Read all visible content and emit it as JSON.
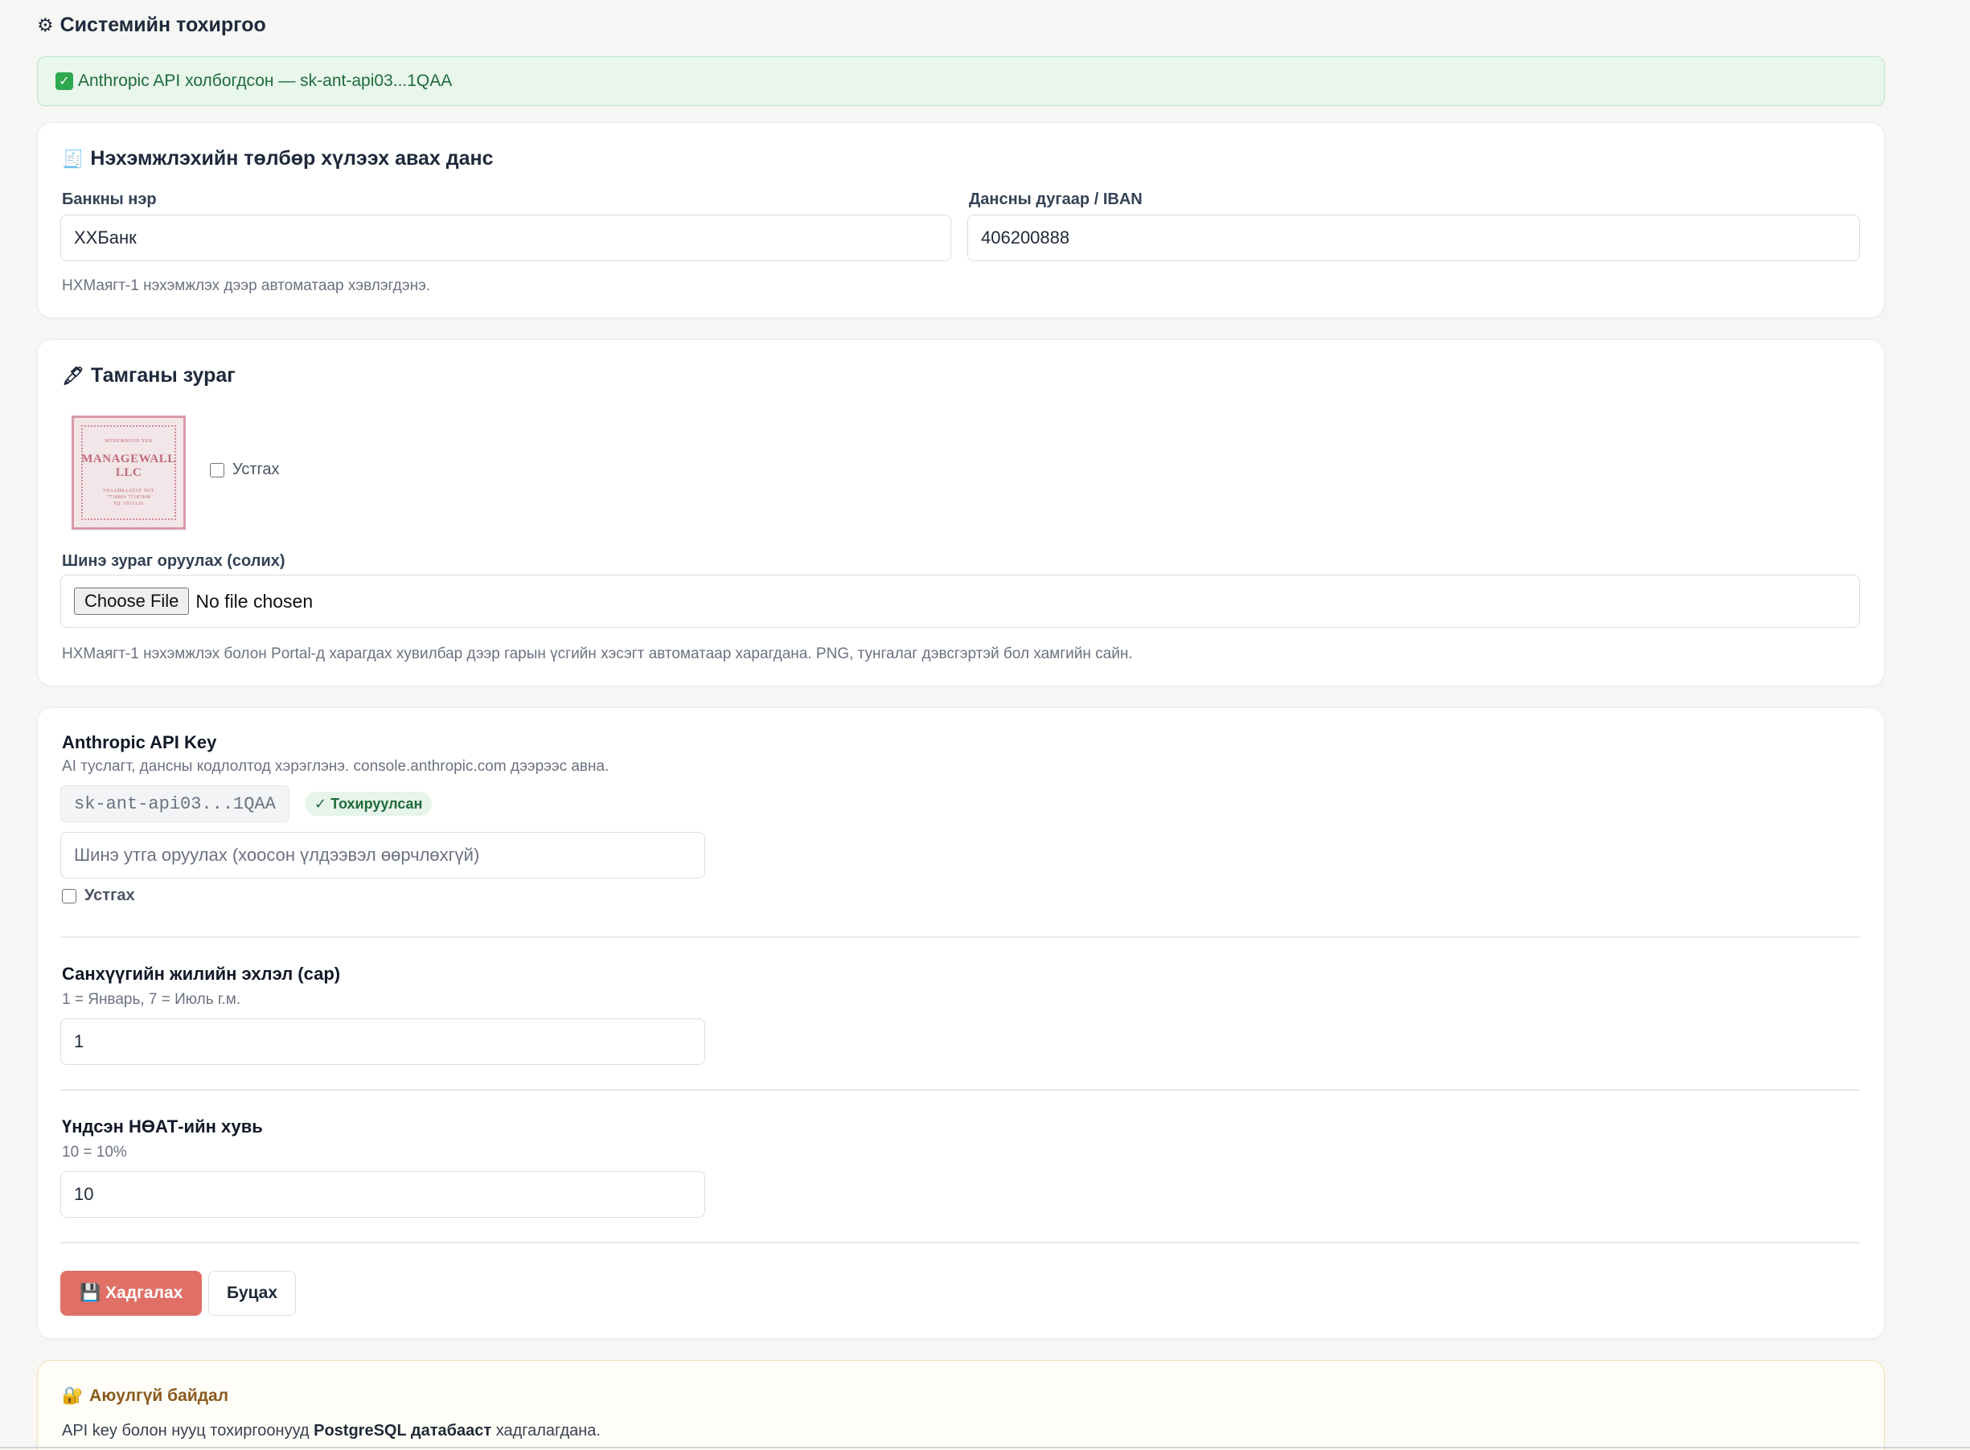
{
  "page": {
    "title": "Системийн тохиргоо",
    "title_icon": "gear-icon"
  },
  "alert": {
    "text": "Anthropic API холбогдсон — sk-ant-api03...1QAA",
    "icon": "check-icon",
    "color": "#1f6b3a"
  },
  "bank_card": {
    "title": "Нэхэмжлэхийн төлбөр хүлээх авах данс",
    "bank_name_label": "Банкны нэр",
    "bank_name_value": "ХХБанк",
    "account_label": "Дансны дугаар / IBAN",
    "account_value": "406200888",
    "hint": "НХМаягт-1 нэхэмжлэх дээр автоматаар хэвлэгдэнэ."
  },
  "stamp_card": {
    "title": "Тамганы зураг",
    "stamp_image": {
      "top_text": "МЕНЕЖВОЛЛ ХХК",
      "name_line1": "MANAGEWALL",
      "name_line2": "LLC",
      "city": "УЛААНБААТАР ХОТ",
      "phone": "7718804  77187848",
      "reg": "РД: 6915126"
    },
    "remove_label": "Устгах",
    "upload_label": "Шинэ зураг оруулах (солих)",
    "choose_file": "Choose File",
    "no_file": "No file chosen",
    "hint": "НХМаягт-1 нэхэмжлэх болон Portal-д харагдах хувилбар дээр гарын үсгийн хэсэгт автоматаар харагдана. PNG, тунгалаг дэвсгэртэй бол хамгийн сайн."
  },
  "api_card": {
    "api_label": "Anthropic API Key",
    "api_hint": "AI туслагт, дансны кодлолтод хэрэглэнэ. console.anthropic.com дээрээс авна.",
    "masked_key": "sk-ant-api03...1QAA",
    "badge": "✓ Тохируулсан",
    "new_key_placeholder": "Шинэ утга оруулах (хоосон үлдээвэл өөрчлөхгүй)",
    "remove_label": "Устгах",
    "fiscal_label": "Санхүүгийн жилийн эхлэл (сар)",
    "fiscal_hint": "1 = Январь, 7 = Июль г.м.",
    "fiscal_value": "1",
    "vat_label": "Үндсэн НӨАТ-ийн хувь",
    "vat_hint": "10 = 10%",
    "vat_value": "10",
    "save_label": "Хадгалах",
    "back_label": "Буцах",
    "save_color": "#e06f66"
  },
  "security_card": {
    "title": "Аюулгүй байдал",
    "text_prefix": "API key болон нууц тохиргоонууд ",
    "text_bold": "PostgreSQL датабааст",
    "text_suffix": " хадгалагдана."
  }
}
